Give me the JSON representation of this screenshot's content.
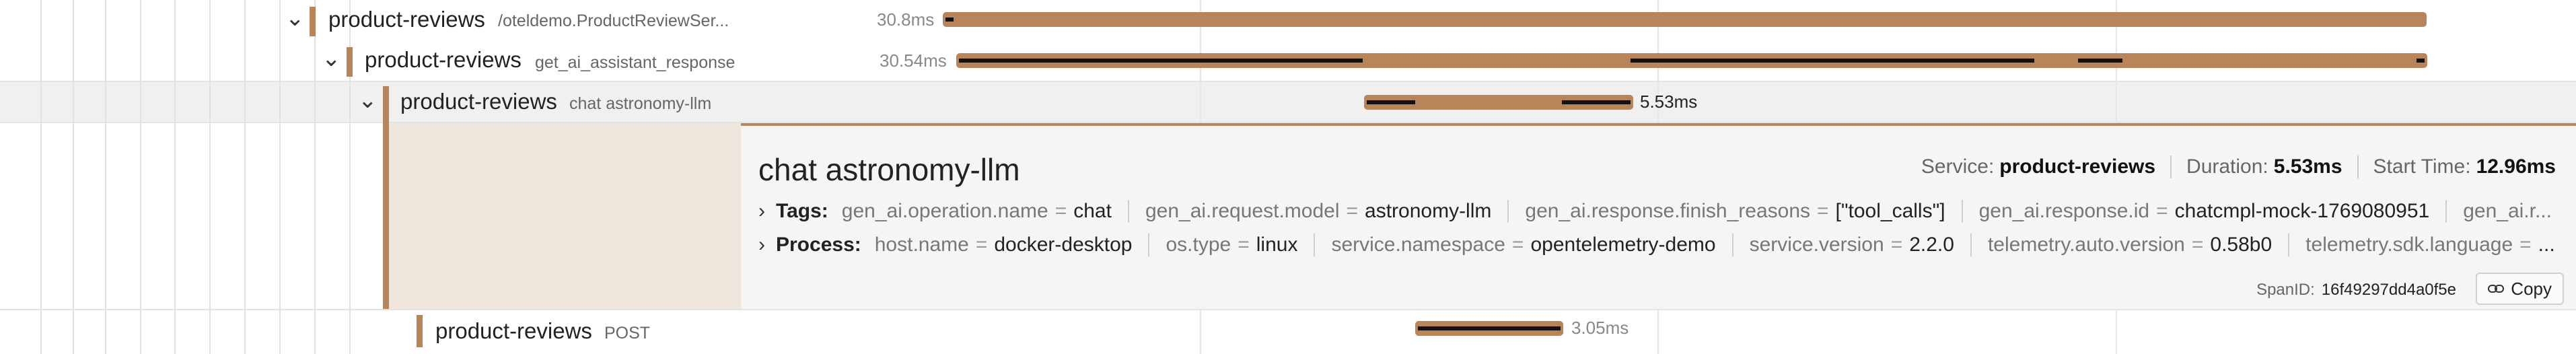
{
  "rows": [
    {
      "service": "product-reviews",
      "operation": "/oteldemo.ProductReviewSer...",
      "duration": "30.8ms"
    },
    {
      "service": "product-reviews",
      "operation": "get_ai_assistant_response",
      "duration": "30.54ms"
    },
    {
      "service": "product-reviews",
      "operation": "chat astronomy-llm",
      "duration": "5.53ms"
    },
    {
      "service": "product-reviews",
      "operation": "POST",
      "duration": "3.05ms"
    }
  ],
  "detail": {
    "title": "chat astronomy-llm",
    "service_label": "Service:",
    "service_value": "product-reviews",
    "duration_label": "Duration:",
    "duration_value": "5.53ms",
    "start_label": "Start Time:",
    "start_value": "12.96ms",
    "tags_label": "Tags:",
    "tags": [
      {
        "key": "gen_ai.operation.name",
        "value": "chat"
      },
      {
        "key": "gen_ai.request.model",
        "value": "astronomy-llm"
      },
      {
        "key": "gen_ai.response.finish_reasons",
        "value": "[\"tool_calls\"]"
      },
      {
        "key": "gen_ai.response.id",
        "value": "chatcmpl-mock-1769080951"
      },
      {
        "key": "gen_ai.r...",
        "value": ""
      }
    ],
    "process_label": "Process:",
    "process": [
      {
        "key": "host.name",
        "value": "docker-desktop"
      },
      {
        "key": "os.type",
        "value": "linux"
      },
      {
        "key": "service.namespace",
        "value": "opentelemetry-demo"
      },
      {
        "key": "service.version",
        "value": "2.2.0"
      },
      {
        "key": "telemetry.auto.version",
        "value": "0.58b0"
      },
      {
        "key": "telemetry.sdk.language",
        "value": "..."
      }
    ],
    "span_id_label": "SpanID:",
    "span_id": "16f49297dd4a0f5e",
    "copy_label": "Copy"
  },
  "colors": {
    "accent": "#b8845a",
    "tint": "#efe6de",
    "child_span": "#111111"
  },
  "icons": {
    "expand": "chevron-down-icon",
    "collapse_tags": "chevron-right-icon",
    "copy": "link-icon"
  }
}
